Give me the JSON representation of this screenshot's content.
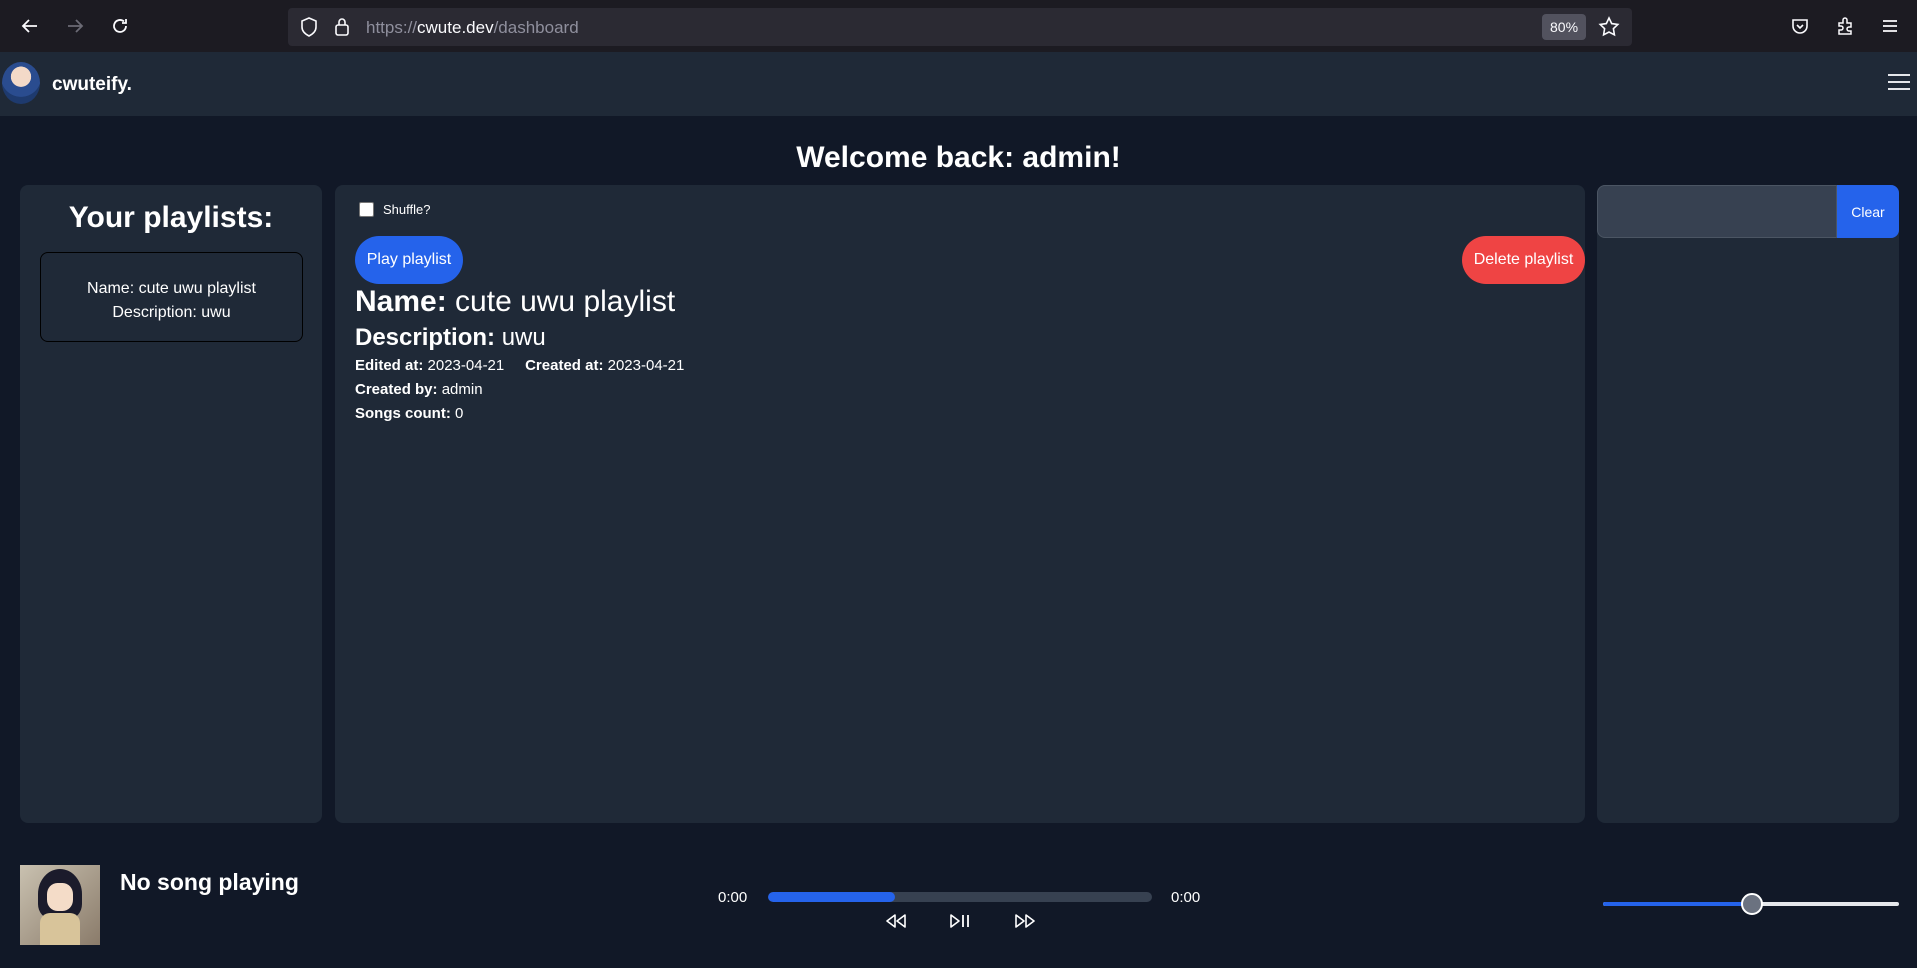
{
  "browser": {
    "url_prefix": "https://",
    "url_host": "cwute.dev",
    "url_path": "/dashboard",
    "zoom": "80%"
  },
  "header": {
    "brand": "cwuteify."
  },
  "welcome": "Welcome back: admin!",
  "sidebar": {
    "title": "Your playlists:",
    "playlists": [
      {
        "name_line": "Name: cute uwu playlist",
        "desc_line": "Description: uwu"
      }
    ]
  },
  "playlist": {
    "shuffle_label": "Shuffle?",
    "play_label": "Play playlist",
    "delete_label": "Delete playlist",
    "name_label": "Name:",
    "name": "cute uwu playlist",
    "desc_label": "Description:",
    "desc": "uwu",
    "edited_label": "Edited at:",
    "edited": "2023-04-21",
    "created_label": "Created at:",
    "created": "2023-04-21",
    "by_label": "Created by:",
    "by": "admin",
    "count_label": "Songs count:",
    "count": "0"
  },
  "search": {
    "value": "",
    "clear_label": "Clear"
  },
  "player": {
    "song": "No song playing",
    "time_current": "0:00",
    "time_total": "0:00",
    "progress_fraction": 0.33,
    "volume_fraction": 0.5
  },
  "colors": {
    "accent": "#2563eb",
    "danger": "#ef4444",
    "panel": "#1f2937",
    "background": "#111827"
  }
}
